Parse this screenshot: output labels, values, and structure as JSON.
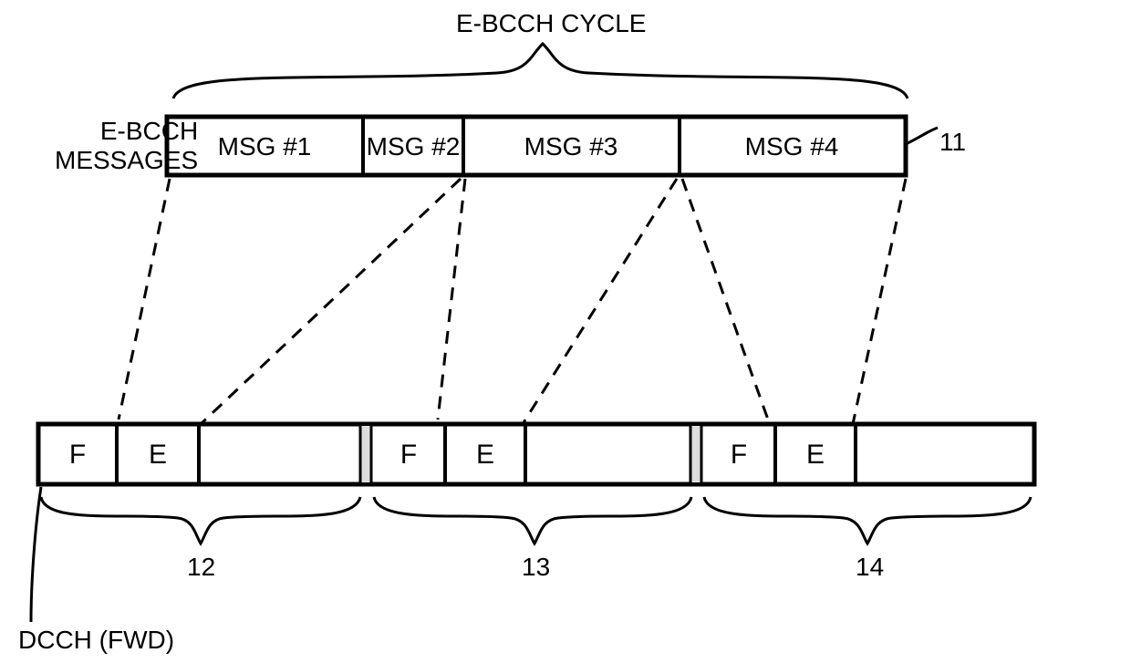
{
  "title": "E-BCCH CYCLE",
  "top_label": "E-BCCH\nMESSAGES",
  "messages": [
    "MSG #1",
    "MSG #2",
    "MSG #3",
    "MSG #4"
  ],
  "callout_top": "11",
  "dcch_label": "DCCH (FWD)",
  "slot_labels": {
    "F": "F",
    "E": "E"
  },
  "brace_numbers": [
    "12",
    "13",
    "14"
  ]
}
